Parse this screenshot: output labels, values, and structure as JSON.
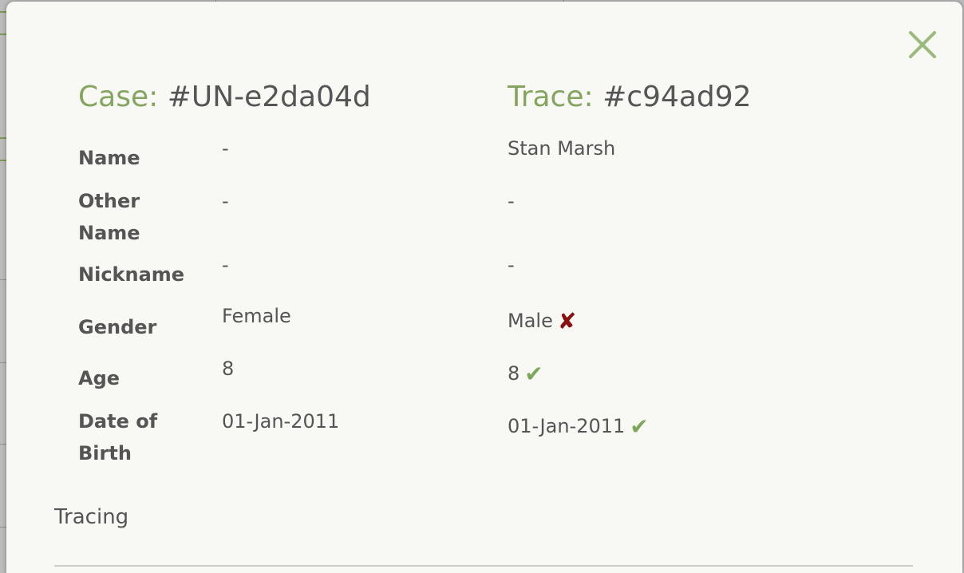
{
  "case": {
    "prefix": "Case:",
    "id": "#UN-e2da04d"
  },
  "trace": {
    "prefix": "Trace:",
    "id": "#c94ad92"
  },
  "fields": {
    "name": {
      "label": "Name",
      "case_value": "-",
      "trace_value": "Stan Marsh",
      "match": ""
    },
    "other_name": {
      "label": "Other Name",
      "case_value": "-",
      "trace_value": "-",
      "match": ""
    },
    "nickname": {
      "label": "Nickname",
      "case_value": "-",
      "trace_value": "-",
      "match": ""
    },
    "gender": {
      "label": "Gender",
      "case_value": "Female",
      "trace_value": "Male",
      "match": "mismatch"
    },
    "age": {
      "label": "Age",
      "case_value": "8",
      "trace_value": "8",
      "match": "match"
    },
    "dob": {
      "label": "Date of Birth",
      "case_value": "01-Jan-2011",
      "trace_value": "01-Jan-2011",
      "match": "match"
    }
  },
  "icons": {
    "mismatch": "x-mark-icon",
    "match": "check-mark-icon",
    "close": "close-icon"
  },
  "colors": {
    "accent": "#84a45f",
    "mismatch": "#8b1010",
    "match": "#7da85a",
    "text": "#555555"
  },
  "section": {
    "tracing_label": "Tracing"
  }
}
